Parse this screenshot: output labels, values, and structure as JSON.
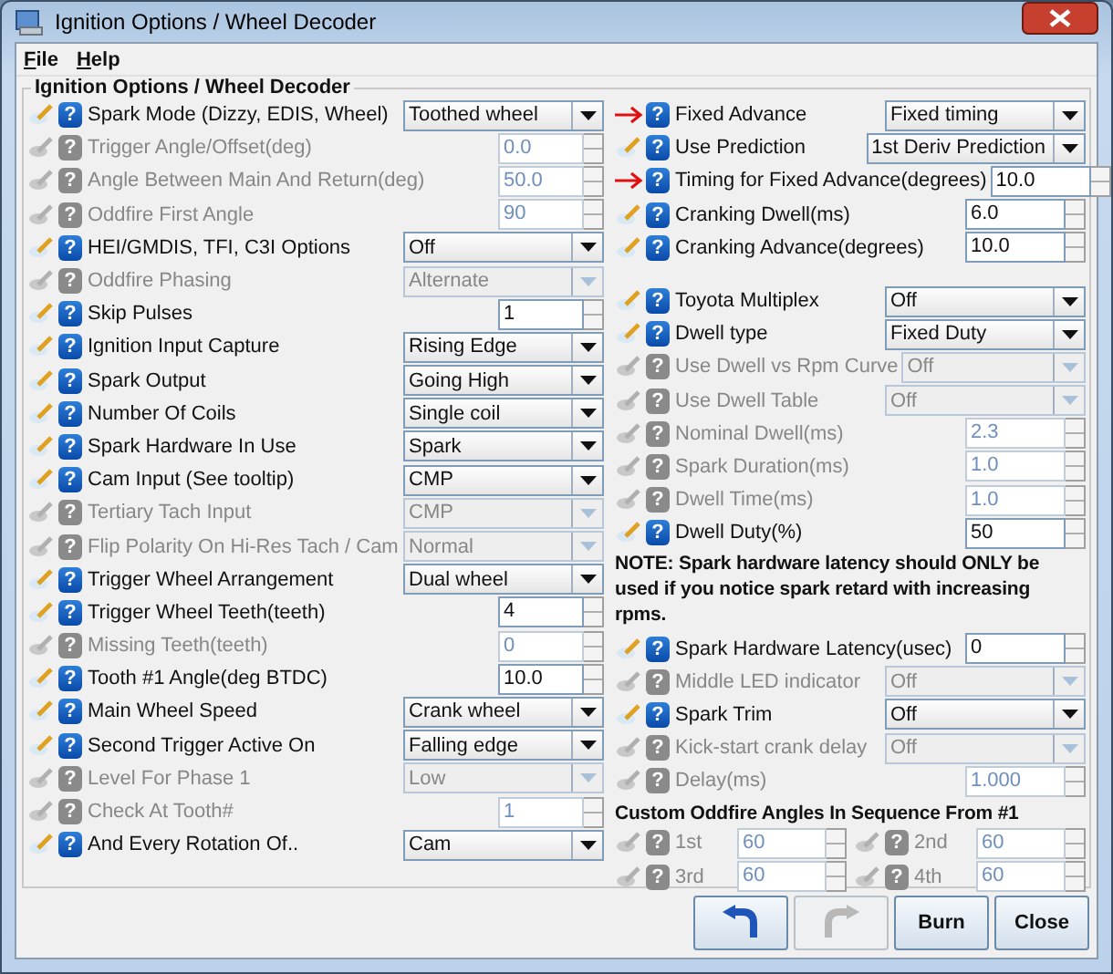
{
  "window": {
    "title": "Ignition Options / Wheel Decoder"
  },
  "menu": [
    {
      "label": "File"
    },
    {
      "label": "Help"
    }
  ],
  "help_glyph": "?",
  "panel": {
    "title": "Ignition Options / Wheel Decoder",
    "columns": [
      {
        "sections": [
          {
            "kind": "rows",
            "rows": [
              {
                "arrow": false,
                "disabled": false,
                "label": "Spark Mode (Dizzy, EDIS, Wheel)",
                "kind": "select",
                "value": "Toothed wheel"
              },
              {
                "arrow": false,
                "disabled": true,
                "label": "Trigger Angle/Offset(deg)",
                "kind": "spinner",
                "value": "0.0"
              },
              {
                "arrow": false,
                "disabled": true,
                "label": "Angle Between Main And Return(deg)",
                "kind": "spinner",
                "value": "50.0"
              },
              {
                "arrow": false,
                "disabled": true,
                "label": "Oddfire First Angle",
                "kind": "spinner",
                "value": "90"
              },
              {
                "arrow": false,
                "disabled": false,
                "label": "HEI/GMDIS, TFI, C3I Options",
                "kind": "select",
                "value": "Off"
              },
              {
                "arrow": false,
                "disabled": true,
                "label": "Oddfire Phasing",
                "kind": "select",
                "value": "Alternate"
              },
              {
                "arrow": false,
                "disabled": false,
                "label": "Skip Pulses",
                "kind": "spinner",
                "value": "1"
              },
              {
                "arrow": false,
                "disabled": false,
                "label": "Ignition Input Capture",
                "kind": "select",
                "value": "Rising Edge"
              },
              {
                "arrow": false,
                "disabled": false,
                "label": "Spark Output",
                "kind": "select",
                "value": "Going High"
              },
              {
                "arrow": false,
                "disabled": false,
                "label": "Number Of Coils",
                "kind": "select",
                "value": "Single coil"
              },
              {
                "arrow": false,
                "disabled": false,
                "label": "Spark Hardware In Use",
                "kind": "select",
                "value": "Spark"
              },
              {
                "arrow": false,
                "disabled": false,
                "label": "Cam Input (See tooltip)",
                "kind": "select",
                "value": "CMP"
              },
              {
                "arrow": false,
                "disabled": true,
                "label": "Tertiary Tach Input",
                "kind": "select",
                "value": "CMP"
              },
              {
                "arrow": false,
                "disabled": true,
                "label": "Flip Polarity On Hi-Res Tach / Cam",
                "kind": "select",
                "value": "Normal"
              },
              {
                "arrow": false,
                "disabled": false,
                "label": "Trigger Wheel Arrangement",
                "kind": "select",
                "value": "Dual wheel"
              },
              {
                "arrow": false,
                "disabled": false,
                "label": "Trigger Wheel Teeth(teeth)",
                "kind": "spinner",
                "value": "4"
              },
              {
                "arrow": false,
                "disabled": true,
                "label": "Missing Teeth(teeth)",
                "kind": "spinner",
                "value": "0"
              },
              {
                "arrow": false,
                "disabled": false,
                "label": "Tooth #1 Angle(deg BTDC)",
                "kind": "spinner",
                "value": "10.0"
              },
              {
                "arrow": false,
                "disabled": false,
                "label": "Main Wheel Speed",
                "kind": "select",
                "value": "Crank wheel"
              },
              {
                "arrow": false,
                "disabled": false,
                "label": "Second Trigger Active On",
                "kind": "select",
                "value": "Falling edge"
              },
              {
                "arrow": false,
                "disabled": true,
                "label": "Level For Phase 1",
                "kind": "select",
                "value": "Low"
              },
              {
                "arrow": false,
                "disabled": true,
                "label": "Check At Tooth#",
                "kind": "spinner",
                "value": "1"
              },
              {
                "arrow": false,
                "disabled": false,
                "label": "And Every Rotation Of..",
                "kind": "select",
                "value": "Cam"
              }
            ]
          }
        ]
      },
      {
        "sections": [
          {
            "kind": "rows",
            "rows": [
              {
                "arrow": true,
                "disabled": false,
                "label": "Fixed Advance",
                "kind": "select",
                "value": "Fixed timing"
              },
              {
                "arrow": false,
                "disabled": false,
                "label": "Use Prediction",
                "kind": "select",
                "value": "1st Deriv Prediction"
              },
              {
                "arrow": true,
                "disabled": false,
                "label": "Timing for Fixed Advance(degrees)",
                "kind": "spinner",
                "value": "10.0"
              },
              {
                "arrow": false,
                "disabled": false,
                "label": "Cranking Dwell(ms)",
                "kind": "spinner",
                "value": "6.0"
              },
              {
                "arrow": false,
                "disabled": false,
                "label": "Cranking Advance(degrees)",
                "kind": "spinner",
                "value": "10.0"
              }
            ]
          },
          {
            "kind": "rows",
            "rows": [
              {
                "arrow": false,
                "disabled": false,
                "label": "Toyota Multiplex",
                "kind": "select",
                "value": "Off"
              },
              {
                "arrow": false,
                "disabled": false,
                "label": "Dwell type",
                "kind": "select",
                "value": "Fixed Duty"
              },
              {
                "arrow": false,
                "disabled": true,
                "label": "Use Dwell vs Rpm Curve",
                "kind": "select",
                "value": "Off"
              },
              {
                "arrow": false,
                "disabled": true,
                "label": "Use Dwell Table",
                "kind": "select",
                "value": "Off"
              },
              {
                "arrow": false,
                "disabled": true,
                "label": "Nominal Dwell(ms)",
                "kind": "spinner",
                "value": "2.3"
              },
              {
                "arrow": false,
                "disabled": true,
                "label": "Spark Duration(ms)",
                "kind": "spinner",
                "value": "1.0"
              },
              {
                "arrow": false,
                "disabled": true,
                "label": "Dwell Time(ms)",
                "kind": "spinner",
                "value": "1.0"
              },
              {
                "arrow": false,
                "disabled": false,
                "label": "Dwell Duty(%)",
                "kind": "spinner",
                "value": "50"
              }
            ]
          },
          {
            "kind": "note",
            "text": "NOTE: Spark hardware latency should ONLY be used if you notice spark retard with increasing rpms."
          },
          {
            "kind": "rows",
            "rows": [
              {
                "arrow": false,
                "disabled": false,
                "label": "Spark Hardware Latency(usec)",
                "kind": "spinner",
                "value": "0"
              },
              {
                "arrow": false,
                "disabled": true,
                "label": "Middle LED indicator",
                "kind": "select",
                "value": "Off"
              },
              {
                "arrow": false,
                "disabled": false,
                "label": "Spark Trim",
                "kind": "select",
                "value": "Off"
              },
              {
                "arrow": false,
                "disabled": true,
                "label": "Kick-start crank delay",
                "kind": "select",
                "value": "Off"
              },
              {
                "arrow": false,
                "disabled": true,
                "label": "Delay(ms)",
                "kind": "spinner",
                "value": "1.000"
              }
            ]
          },
          {
            "kind": "heading",
            "text": "Custom Oddfire Angles In Sequence From #1"
          },
          {
            "kind": "pairs",
            "items": [
              {
                "disabled": true,
                "label": "1st",
                "value": "60"
              },
              {
                "disabled": true,
                "label": "2nd",
                "value": "60"
              },
              {
                "disabled": true,
                "label": "3rd",
                "value": "60"
              },
              {
                "disabled": true,
                "label": "4th",
                "value": "60"
              }
            ]
          }
        ]
      }
    ]
  },
  "buttons": [
    {
      "kind": "undo",
      "disabled": false
    },
    {
      "kind": "redo",
      "disabled": true
    },
    {
      "kind": "text",
      "label": "Burn",
      "disabled": false
    },
    {
      "kind": "text",
      "label": "Close",
      "disabled": false
    }
  ]
}
